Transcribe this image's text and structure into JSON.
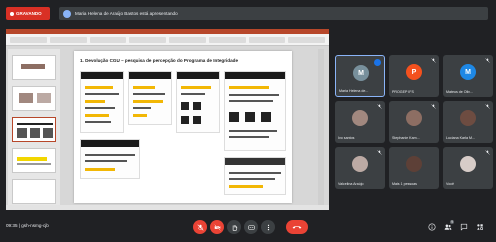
{
  "topbar": {
    "recording_label": "GRAVANDO",
    "presenter_text": "Maria Helena de Araújo Bastos está apresentando"
  },
  "presentation": {
    "slide_title": "1. Devolução CGU – pesquisa de percepção do Programa de Integridade"
  },
  "participants": [
    {
      "name": "Maria Helena de...",
      "initial": "M",
      "color": "#78909c",
      "muted": false,
      "pinned": true
    },
    {
      "name": "PROGEP IFS",
      "initial": "P",
      "color": "#f4511e",
      "muted": true,
      "pinned": false
    },
    {
      "name": "Mateus de Oliv...",
      "initial": "M",
      "color": "#1e88e5",
      "muted": true,
      "pinned": false
    },
    {
      "name": "Ivo santos",
      "initial": "",
      "color": "#a1887f",
      "muted": true,
      "pinned": false
    },
    {
      "name": "Stephanie Kam...",
      "initial": "",
      "color": "#8d6e63",
      "muted": true,
      "pinned": false
    },
    {
      "name": "Luciana Karla M...",
      "initial": "",
      "color": "#6d4c41",
      "muted": true,
      "pinned": false
    },
    {
      "name": "Valcelina Araújo",
      "initial": "",
      "color": "#bcaaa4",
      "muted": true,
      "pinned": false
    },
    {
      "name": "Mais 1 pessoas",
      "initial": "",
      "color": "#5d4037",
      "muted": false,
      "pinned": false
    },
    {
      "name": "Você",
      "initial": "",
      "color": "#d7ccc8",
      "muted": true,
      "pinned": false
    }
  ],
  "bottombar": {
    "meeting_info": "09:35 | gsh-nsmg-cjb",
    "controls": [
      "mic-off",
      "camera-off",
      "raise-hand",
      "captions",
      "more",
      "hangup"
    ],
    "right_controls": [
      "info",
      "people",
      "chat",
      "activities"
    ],
    "people_count": "9"
  },
  "colors": {
    "accent_red": "#ea4335",
    "bg": "#202124",
    "tile": "#3c4043"
  }
}
